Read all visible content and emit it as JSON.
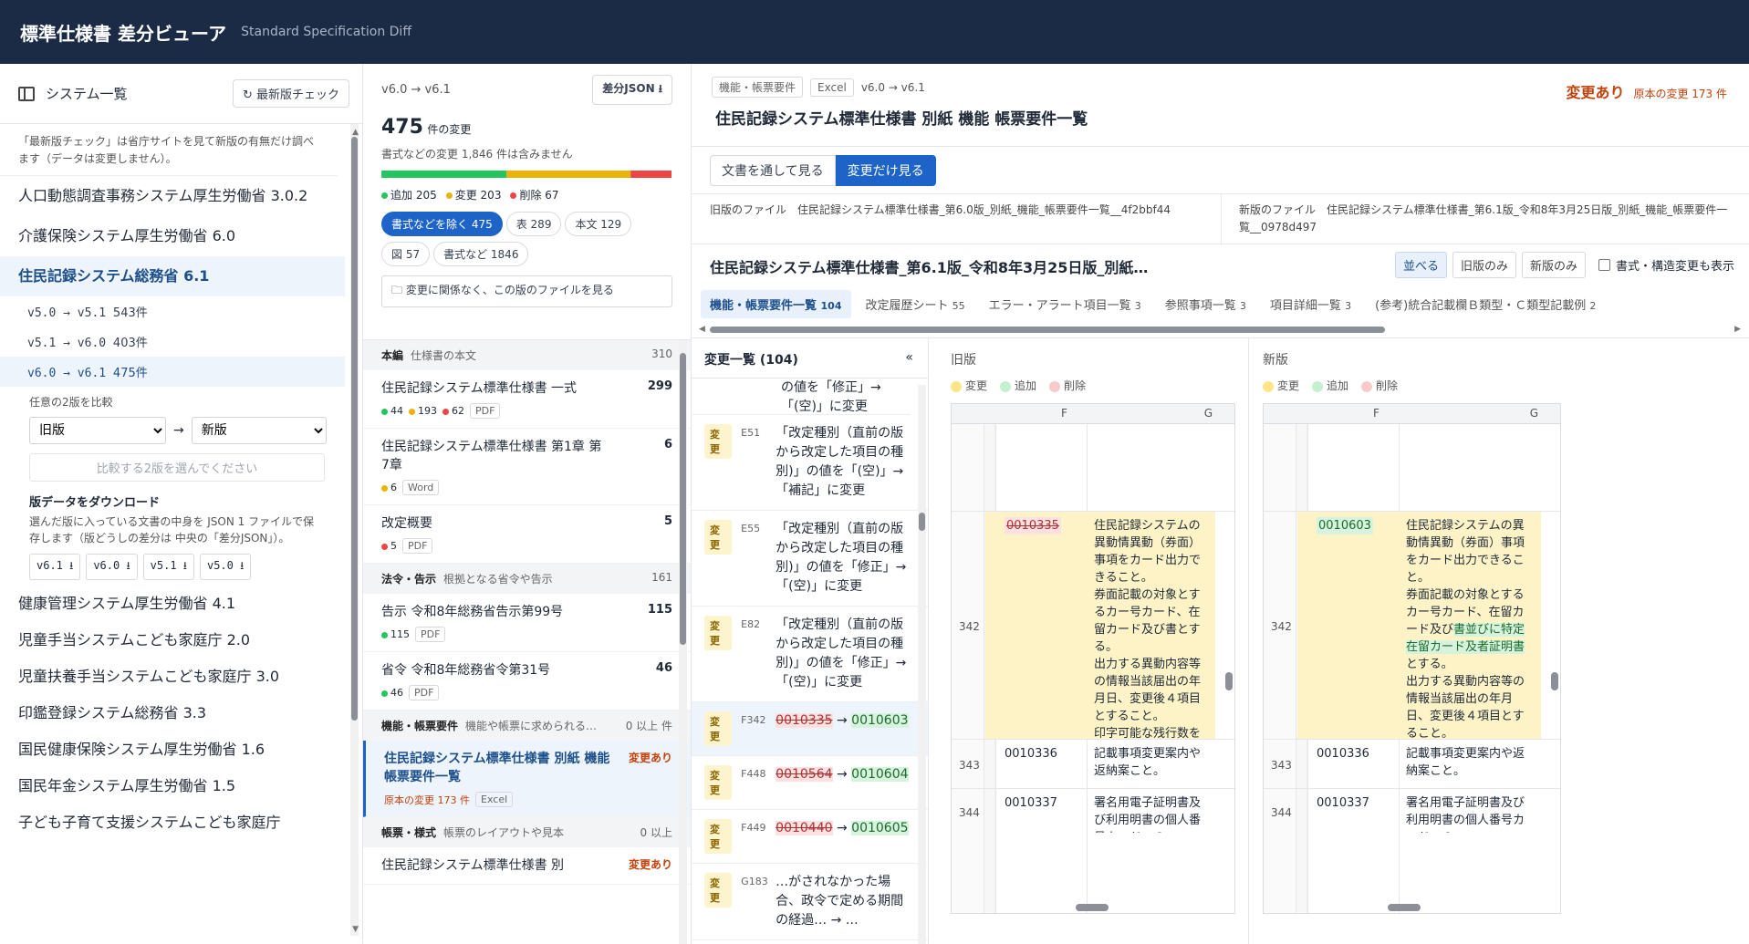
{
  "header": {
    "title": "標準仕様書 差分ビューア",
    "subtitle": "Standard Specification Diff"
  },
  "sidebar": {
    "title": "システム一覧",
    "check_btn": "最新版チェック",
    "note": "「最新版チェック」は省庁サイトを見て新版の有無だけ調べます（データは変更しません）。",
    "systems_top": [
      "人口動態調査事務システム厚生労働省 3.0.2",
      "介護保険システム厚生労働省 6.0",
      "住民記録システム総務省 6.1"
    ],
    "versions": [
      {
        "label": "v5.0 → v5.1",
        "count": "543件"
      },
      {
        "label": "v5.1 → v6.0",
        "count": "403件"
      },
      {
        "label": "v6.0 → v6.1",
        "count": "475件"
      }
    ],
    "compare_label": "任意の2版を比較",
    "old_select": "旧版",
    "new_select": "新版",
    "compare_hint": "比較する2版を選んでください",
    "dl_title": "版データをダウンロード",
    "dl_desc": "選んだ版に入っている文書の中身を JSON 1 ファイルで保存します（版どうしの差分は 中央の「差分JSON」）。",
    "dl_buttons": [
      "v6.1 ⭳",
      "v6.0 ⭳",
      "v5.1 ⭳",
      "v5.0 ⭳"
    ],
    "systems_bottom": [
      "健康管理システム厚生労働省 4.1",
      "児童手当システムこども家庭庁 2.0",
      "児童扶養手当システムこども家庭庁 3.0",
      "印鑑登録システム総務省 3.3",
      "国民健康保険システム厚生労働省 1.6",
      "国民年金システム厚生労働省 1.5",
      "子ども子育て支援システムこども家庭庁"
    ]
  },
  "summary": {
    "range": "v6.0 → v6.1",
    "json_btn": "差分JSON ⭳",
    "count": "475",
    "count_unit": "件の変更",
    "excluded": "書式などの変更 1,846 件は含みません",
    "bar": {
      "add": 205,
      "change": 203,
      "delete": 67,
      "add_color": "#22c55e",
      "change_color": "#eab308",
      "delete_color": "#ef4444"
    },
    "legend": {
      "add": "追加 205",
      "change": "変更 203",
      "delete": "削除 67"
    },
    "filters": [
      "書式などを除く 475",
      "表 289",
      "本文 129",
      "図 57",
      "書式など 1846"
    ],
    "view_file": "変更に関係なく、この版のファイルを見る"
  },
  "sections": [
    {
      "title": "本編",
      "sub": "仕様書の本文",
      "count": "310",
      "items": [
        {
          "name": "住民記録システム標準仕様書 一式",
          "count": "299",
          "meta": [
            {
              "c": "#22c55e",
              "v": "44"
            },
            {
              "c": "#eab308",
              "v": "193"
            },
            {
              "c": "#ef4444",
              "v": "62"
            }
          ],
          "tag": "PDF"
        },
        {
          "name": "住民記録システム標準仕様書 第1章 第7章",
          "count": "6",
          "meta": [
            {
              "c": "#eab308",
              "v": "6"
            }
          ],
          "tag": "Word"
        },
        {
          "name": "改定概要",
          "count": "5",
          "meta": [
            {
              "c": "#ef4444",
              "v": "5"
            }
          ],
          "tag": "PDF"
        }
      ]
    },
    {
      "title": "法令・告示",
      "sub": "根拠となる省令や告示",
      "count": "161",
      "items": [
        {
          "name": "告示 令和8年総務省告示第99号",
          "count": "115",
          "meta": [
            {
              "c": "#22c55e",
              "v": "115"
            }
          ],
          "tag": "PDF"
        },
        {
          "name": "省令 令和8年総務省令第31号",
          "count": "46",
          "meta": [
            {
              "c": "#22c55e",
              "v": "46"
            }
          ],
          "tag": "PDF"
        }
      ]
    },
    {
      "title": "機能・帳票要件",
      "sub": "機能や帳票に求められる…",
      "count": "0 以上 件",
      "items": [
        {
          "name": "住民記録システム標準仕様書 別紙 機能 帳票要件一覧",
          "badge": "変更あり",
          "orig": "原本の変更 173 件",
          "tag": "Excel",
          "selected": true
        }
      ]
    },
    {
      "title": "帳票・様式",
      "sub": "帳票のレイアウトや見本",
      "count": "0 以上",
      "items": [
        {
          "name": "住民記録システム標準仕様書 別",
          "badge": "変更あり"
        }
      ]
    }
  ],
  "doc": {
    "tag1": "機能・帳票要件",
    "tag2": "Excel",
    "range": "v6.0 → v6.1",
    "title": "住民記録システム標準仕様書 別紙 機能 帳票要件一覧",
    "status": "変更あり",
    "orig": "原本の変更 173 件",
    "mode_btns": [
      "文書を通して見る",
      "変更だけ見る"
    ],
    "old_file_label": "旧版のファイル",
    "old_file": "住民記録システム標準仕様書_第6.0版_別紙_機能_帳票要件一覧__4f2bbf44",
    "new_file_label": "新版のファイル",
    "new_file": "住民記録システム標準仕様書_第6.1版_令和8年3月25日版_別紙_機能_帳票要件一覧__0978d497",
    "file_title": "住民記録システム標準仕様書_第6.1版_令和8年3月25日版_別紙…",
    "view_btns": [
      "並べる",
      "旧版のみ",
      "新版のみ"
    ],
    "show_format": "書式・構造変更も表示",
    "sheets": [
      {
        "n": "機能・帳票要件一覧",
        "c": "104"
      },
      {
        "n": "改定履歴シート",
        "c": "55"
      },
      {
        "n": "エラー・アラート項目一覧",
        "c": "3"
      },
      {
        "n": "参照事項一覧",
        "c": "3"
      },
      {
        "n": "項目詳細一覧",
        "c": "3"
      },
      {
        "n": "(参考)統合記載欄Ｂ類型・Ｃ類型記載例",
        "c": "2"
      }
    ]
  },
  "changes": {
    "title": "変更一覧 (104)",
    "collapse": "«",
    "top_cut": "の値を「修正」→「(空)」に変更",
    "badge": "変更",
    "items": [
      {
        "code": "E51",
        "text": "「改定種別（直前の版から改定した項目の種別)」の値を「(空)」→「補記」に変更"
      },
      {
        "code": "E55",
        "text": "「改定種別（直前の版から改定した項目の種別)」の値を「修正」→「(空)」に変更"
      },
      {
        "code": "E82",
        "text": "「改定種別（直前の版から改定した項目の種別)」の値を「修正」→「(空)」に変更"
      },
      {
        "code": "F342",
        "old": "0010335",
        "new": "0010603"
      },
      {
        "code": "F448",
        "old": "0010564",
        "new": "0010604"
      },
      {
        "code": "F449",
        "old": "0010440",
        "new": "0010605"
      },
      {
        "code": "G183",
        "text": "…がされなかった場合、政令で定める期間の経過… → …"
      }
    ]
  },
  "panes": {
    "old": {
      "title": "旧版",
      "legend": [
        "変更",
        "追加",
        "削除"
      ],
      "colF": "F",
      "colG": "G",
      "rows": [
        {
          "n": "342",
          "f": "0010335",
          "g": "住民記録システムの異動情異動（券面）事項をカード出力できること。\n券面記載の対象とするカー号カード、在留カード及び書とする。\n出力する異動内容等の情報当該届出の年月日、変更後４項目とすること。\n印字可能な残行数を指定す字文字サイズや印字行数をと。"
        },
        {
          "n": "343",
          "f": "0010336",
          "g": "記載事項変更案内や返納案こと。"
        },
        {
          "n": "344",
          "f": "0010337",
          "g": "署名用電子証明書及び利用明書の個人番号カードへの"
        }
      ]
    },
    "new": {
      "title": "新版",
      "legend": [
        "変更",
        "追加",
        "削除"
      ],
      "colF": "F",
      "colG": "G",
      "rows": [
        {
          "n": "342",
          "f": "0010603",
          "g1": "住民記録システムの異動情異動（券面）事項をカード出力できること。\n券面記載の対象とするカー号カード、在留カード及び",
          "gadd": "書並びに特定在留カード及者証明書",
          "g2": "とする。\n出力する異動内容等の情報当該届出の年月日、変更後４項目とすること。\n印字可能な残行数を指定す字文字サイズや印字行数をと。"
        },
        {
          "n": "343",
          "f": "0010336",
          "g": "記載事項変更案内や返納案こと。"
        },
        {
          "n": "344",
          "f": "0010337",
          "g": "署名用電子証明書及び利用明書の個人番号カードへの"
        }
      ]
    }
  }
}
